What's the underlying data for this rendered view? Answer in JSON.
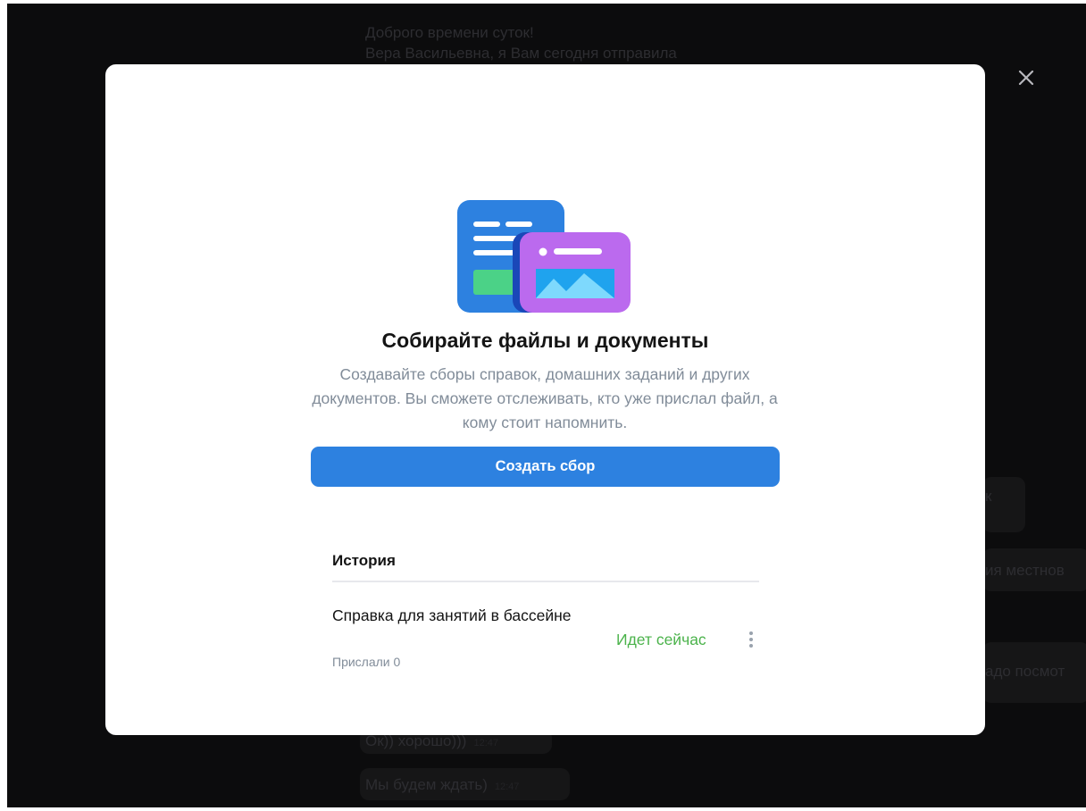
{
  "background_chat": {
    "messages": [
      {
        "text": "Доброго времени суток!"
      },
      {
        "text": "Вера Васильевна, я Вам сегодня отправила"
      },
      {
        "text": "к"
      },
      {
        "text": "ия местнов"
      },
      {
        "text": "адо посмот"
      },
      {
        "text": "Ок)) хорошо)))",
        "time": "12:47"
      },
      {
        "text": "Мы будем ждать)",
        "time": "12:47"
      }
    ]
  },
  "modal": {
    "title": "Собирайте файлы и документы",
    "description": "Создавайте сборы справок, домашних заданий и других документов. Вы сможете отслеживать, кто уже прислал файл, а кому стоит напомнить.",
    "create_button": "Создать сбор",
    "history_title": "История",
    "items": [
      {
        "name": "Справка для занятий в бассейне",
        "sub": "Прислали 0",
        "status": "Идет сейчас"
      }
    ]
  },
  "icons": {
    "close": "close-icon",
    "illustration": "documents-illustration",
    "more": "more-vertical-icon"
  },
  "colors": {
    "accent": "#2d81e0",
    "status_active": "#4bb34b",
    "secondary_text": "#818c99",
    "overlay": "#0c0c0d"
  }
}
